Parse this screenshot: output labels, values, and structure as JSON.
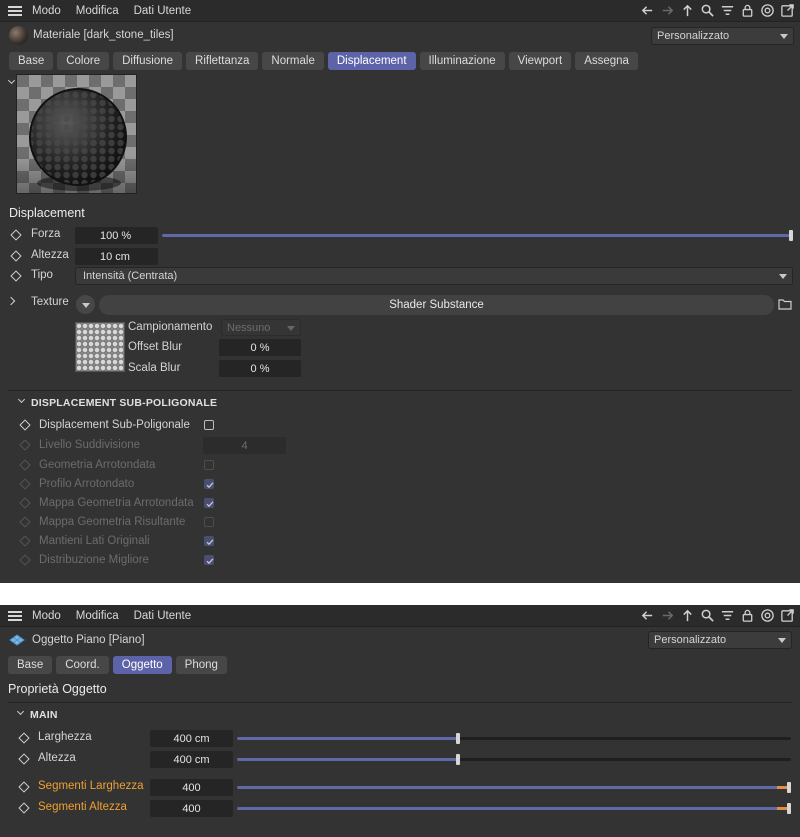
{
  "menu": {
    "items": [
      "Modo",
      "Modifica",
      "Dati Utente"
    ]
  },
  "material_panel": {
    "title": "Materiale [dark_stone_tiles]",
    "mode_select": "Personalizzato",
    "tabs": [
      {
        "label": "Base",
        "active": false
      },
      {
        "label": "Colore",
        "active": false
      },
      {
        "label": "Diffusione",
        "active": false
      },
      {
        "label": "Riflettanza",
        "active": false
      },
      {
        "label": "Normale",
        "active": false
      },
      {
        "label": "Displacement",
        "active": true
      },
      {
        "label": "Illuminazione",
        "active": false
      },
      {
        "label": "Viewport",
        "active": false
      },
      {
        "label": "Assegna",
        "active": false
      }
    ],
    "section_title": "Displacement",
    "forza": {
      "label": "Forza",
      "value": "100 %",
      "slider_fraction": 1.0
    },
    "altezza": {
      "label": "Altezza",
      "value": "10 cm"
    },
    "tipo": {
      "label": "Tipo",
      "value": "Intensità (Centrata)"
    },
    "texture": {
      "label": "Texture",
      "shader_button": "Shader Substance",
      "campionamento_label": "Campionamento",
      "campionamento_value": "Nessuno",
      "offset_blur_label": "Offset Blur",
      "offset_blur_value": "0 %",
      "scala_blur_label": "Scala Blur",
      "scala_blur_value": "0 %"
    },
    "subpoly": {
      "header": "DISPLACEMENT SUB-POLIGONALE",
      "enable_label": "Displacement Sub-Poligonale",
      "enable_checked": false,
      "livello_label": "Livello Suddivisione",
      "livello_value": "4",
      "options": [
        {
          "label": "Geometria Arrotondata",
          "checked": false
        },
        {
          "label": "Profilo Arrotondato",
          "checked": true
        },
        {
          "label": "Mappa Geometria Arrotondata",
          "checked": true
        },
        {
          "label": "Mappa Geometria Risultante",
          "checked": false
        },
        {
          "label": "Mantieni Lati Originali",
          "checked": true
        },
        {
          "label": "Distribuzione Migliore",
          "checked": true
        }
      ]
    }
  },
  "object_panel": {
    "title": "Oggetto Piano [Piano]",
    "mode_select": "Personalizzato",
    "tabs": [
      {
        "label": "Base",
        "active": false
      },
      {
        "label": "Coord.",
        "active": false
      },
      {
        "label": "Oggetto",
        "active": true
      },
      {
        "label": "Phong",
        "active": false
      }
    ],
    "section_title": "Proprietà Oggetto",
    "main_header": "MAIN",
    "params": [
      {
        "label": "Larghezza",
        "value": "400 cm",
        "slider_fraction": 0.4,
        "highlight": false
      },
      {
        "label": "Altezza",
        "value": "400 cm",
        "slider_fraction": 0.4,
        "highlight": false
      },
      {
        "label": "Segmenti Larghezza",
        "value": "400",
        "slider_fraction": 1.0,
        "highlight": true
      },
      {
        "label": "Segmenti Altezza",
        "value": "400",
        "slider_fraction": 1.0,
        "highlight": true
      }
    ]
  },
  "colors": {
    "panel_bg": "#333333",
    "accent": "#5c63a8",
    "highlight_label": "#f0a030"
  }
}
